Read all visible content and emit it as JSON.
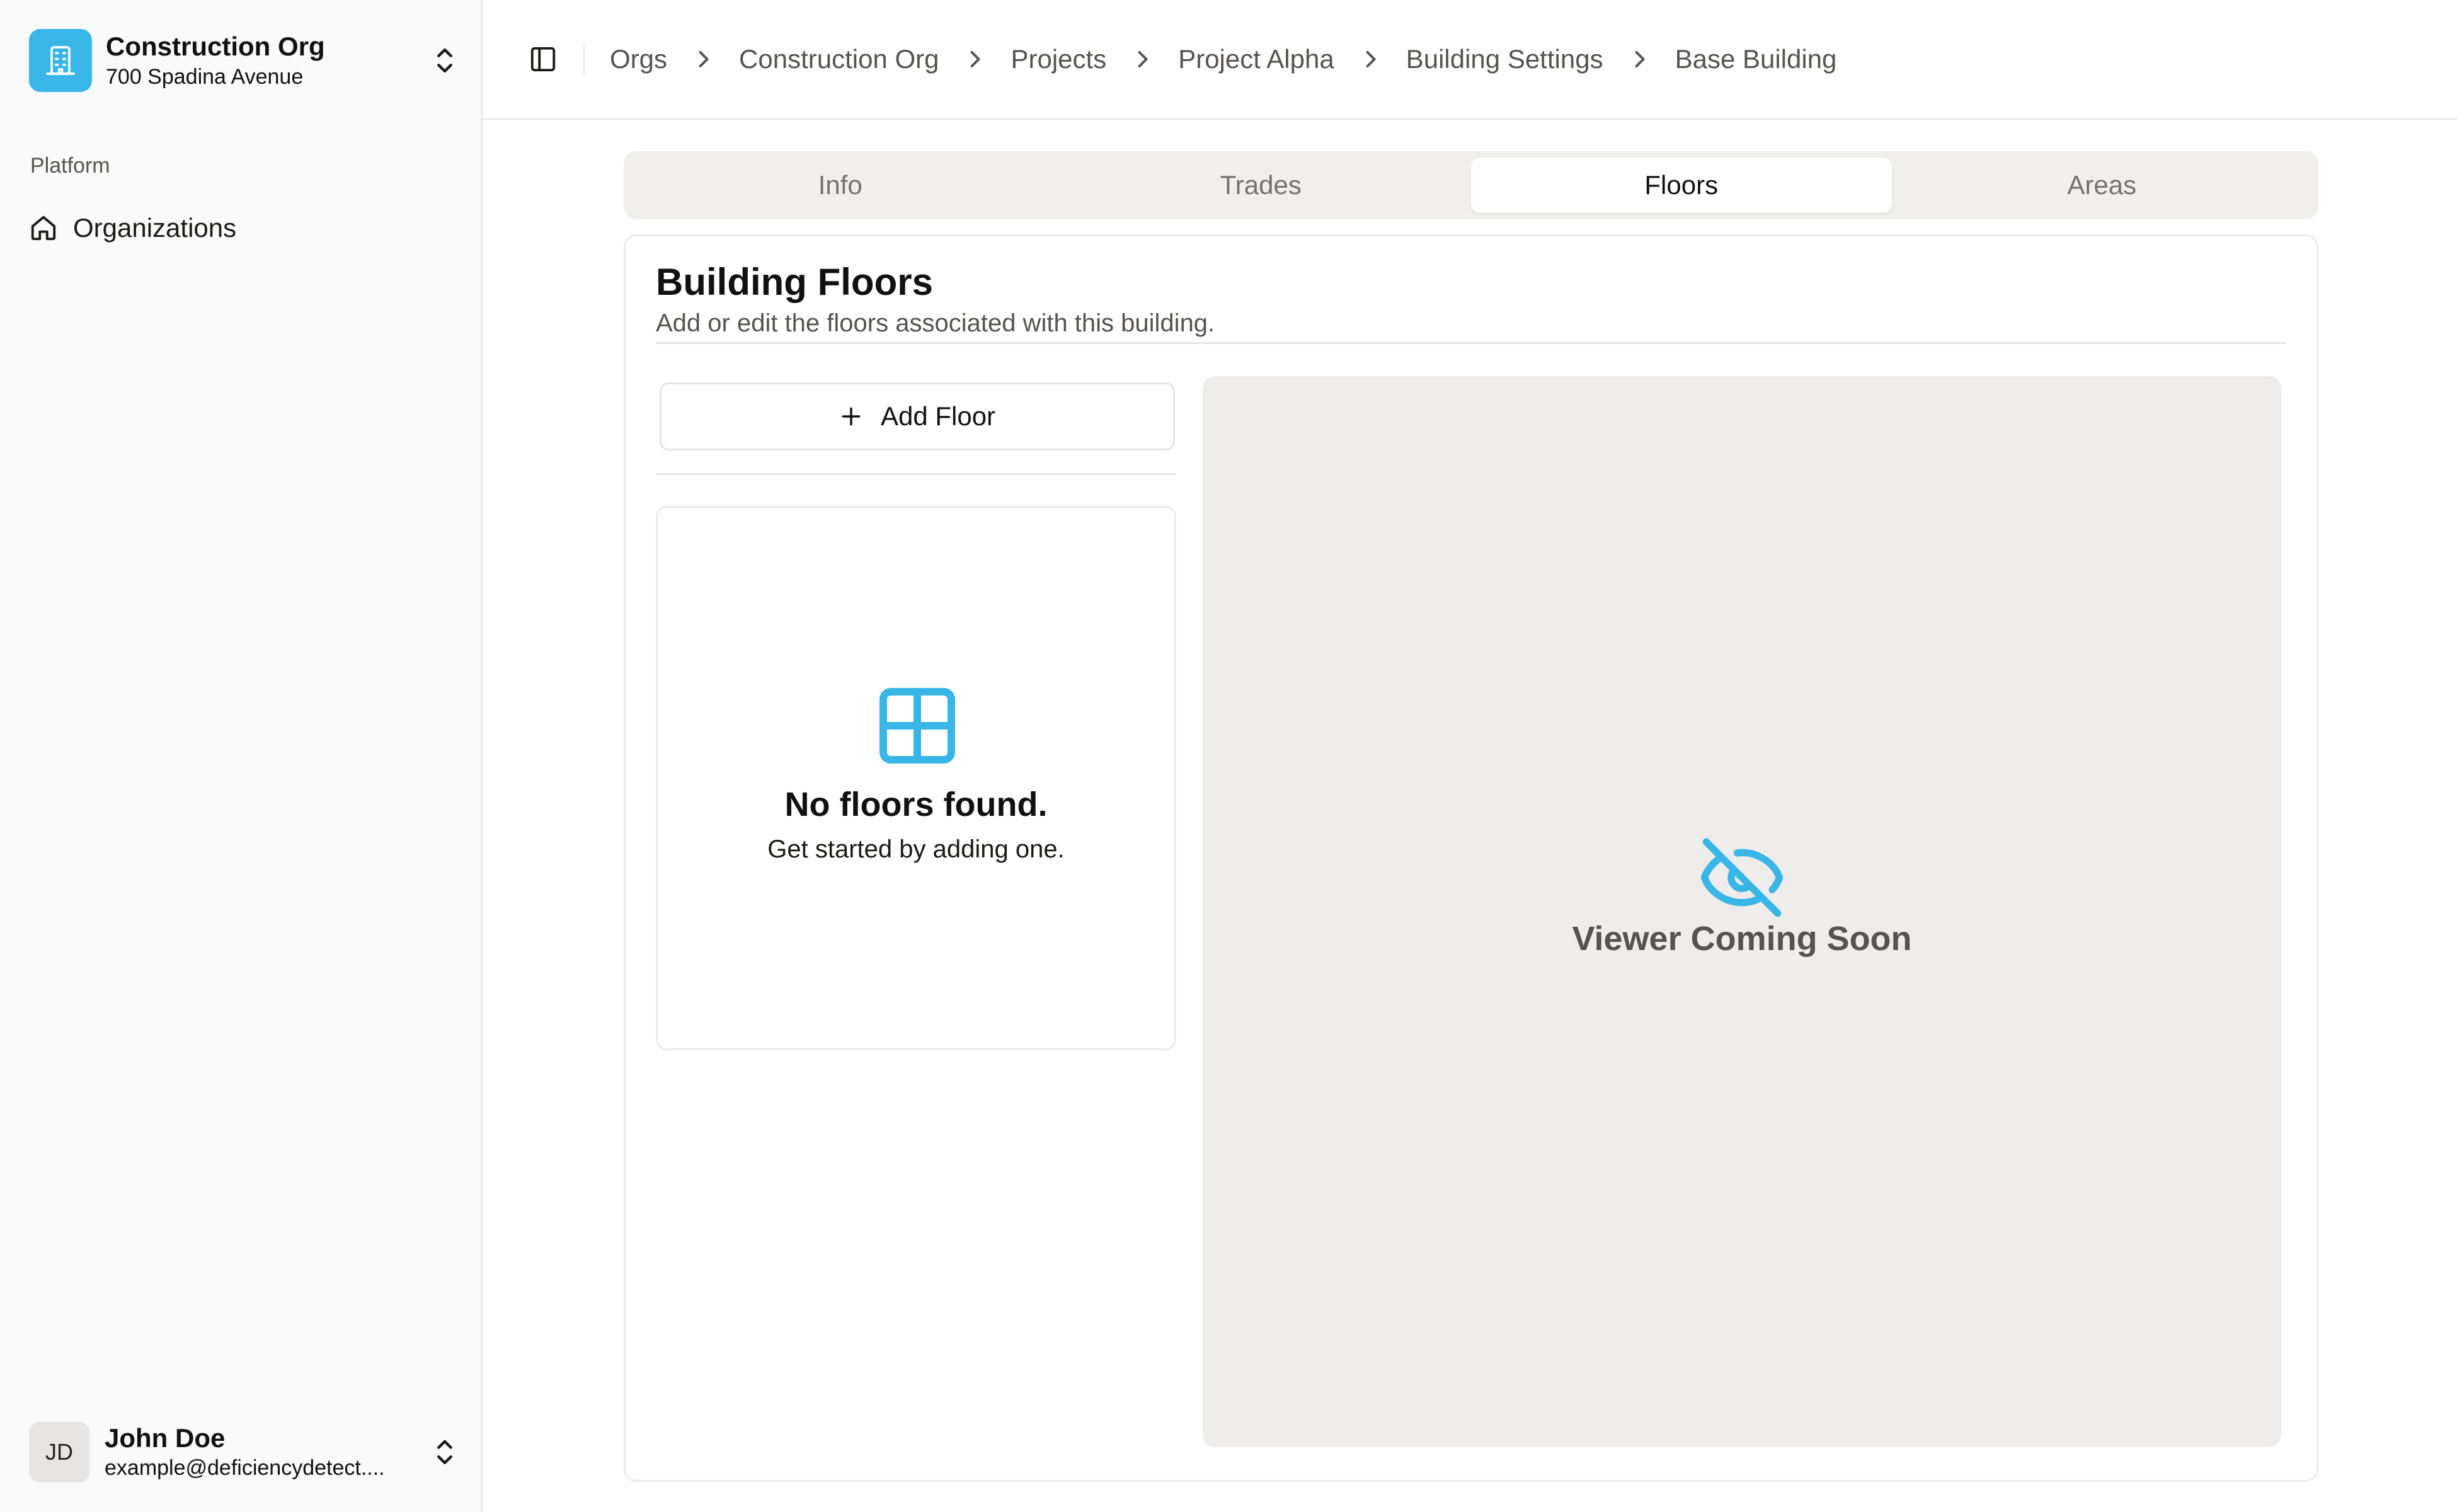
{
  "sidebar": {
    "org": {
      "name": "Construction Org",
      "address": "700 Spadina Avenue"
    },
    "group_label": "Platform",
    "items": [
      {
        "label": "Organizations",
        "icon": "home-icon"
      }
    ],
    "user": {
      "initials": "JD",
      "name": "John Doe",
      "email": "example@deficiencydetect...."
    }
  },
  "breadcrumb": [
    {
      "label": "Orgs"
    },
    {
      "label": "Construction Org"
    },
    {
      "label": "Projects"
    },
    {
      "label": "Project Alpha"
    },
    {
      "label": "Building Settings"
    },
    {
      "label": "Base Building"
    }
  ],
  "tabs": [
    {
      "label": "Info"
    },
    {
      "label": "Trades"
    },
    {
      "label": "Floors",
      "active": true
    },
    {
      "label": "Areas"
    }
  ],
  "card": {
    "title": "Building Floors",
    "description": "Add or edit the floors associated with this building.",
    "add_button_label": "Add Floor",
    "empty_title": "No floors found.",
    "empty_subtitle": "Get started by adding one.",
    "viewer_text": "Viewer Coming Soon"
  },
  "colors": {
    "accent": "#38b6e8",
    "tab_track": "#f0efed",
    "viewer_bg": "#eeedeb"
  }
}
